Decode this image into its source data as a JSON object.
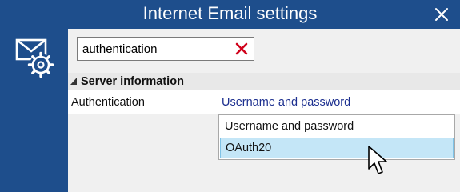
{
  "window": {
    "title": "Internet Email settings"
  },
  "search": {
    "value": "authentication"
  },
  "section": {
    "title": "Server information"
  },
  "property": {
    "label": "Authentication",
    "value": "Username and password"
  },
  "dropdown": {
    "options": [
      "Username and password",
      "OAuth20"
    ],
    "highlighted": "OAuth20"
  },
  "colors": {
    "titlebar": "#1e4e8c",
    "panel": "#f0f0f0",
    "link_text": "#1c2f8f",
    "highlight": "#c4e6f7",
    "clear_icon": "#d0021b"
  },
  "icons": {
    "close": "close-icon",
    "app": "email-settings-icon",
    "clear": "clear-search-icon",
    "collapse": "collapse-triangle-icon",
    "cursor": "mouse-pointer-icon"
  }
}
